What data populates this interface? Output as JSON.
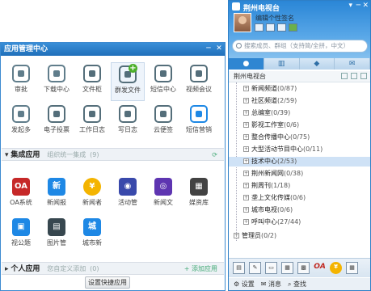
{
  "app_manager": {
    "title": "应用管理中心",
    "apps_row1": [
      {
        "label": "审批",
        "icon": "approval-icon",
        "color": "#607d8b"
      },
      {
        "label": "下载中心",
        "icon": "download-icon",
        "color": "#607d8b"
      },
      {
        "label": "文件柜",
        "icon": "cabinet-icon",
        "color": "#546e7a"
      },
      {
        "label": "群发文件",
        "icon": "group-file-icon",
        "color": "#546e7a"
      },
      {
        "label": "短信中心",
        "icon": "sms-icon",
        "color": "#546e7a"
      },
      {
        "label": "视频会议",
        "icon": "video-meeting-icon",
        "color": "#546e7a"
      }
    ],
    "apps_row2": [
      {
        "label": "发起多",
        "icon": "initiate-icon",
        "color": "#607d8b"
      },
      {
        "label": "电子投票",
        "icon": "vote-icon",
        "color": "#546e7a"
      },
      {
        "label": "工作日志",
        "icon": "worklog-icon",
        "color": "#546e7a"
      },
      {
        "label": "写日志",
        "icon": "write-log-icon",
        "color": "#546e7a"
      },
      {
        "label": "云便签",
        "icon": "cloud-note-icon",
        "color": "#546e7a"
      },
      {
        "label": "短信营销",
        "icon": "sms-marketing-icon",
        "color": "#1e88e5"
      }
    ],
    "integrated": {
      "title": "集成应用",
      "subtitle": "组织统一集成",
      "count": "(9)",
      "apps_row1": [
        {
          "label": "OA系统",
          "icon": "oa-icon",
          "color": "#c62828",
          "glyph": "OA"
        },
        {
          "label": "新闻报",
          "icon": "news-icon",
          "color": "#1e88e5",
          "glyph": "新"
        },
        {
          "label": "新闻者",
          "icon": "yen-icon",
          "color": "#f4b400",
          "glyph": "¥"
        },
        {
          "label": "活动管",
          "icon": "event-icon",
          "color": "#3949ab",
          "glyph": "◉"
        },
        {
          "label": "新闻文",
          "icon": "news-text-icon",
          "color": "#5e35b1",
          "glyph": "◎"
        },
        {
          "label": "媒资库",
          "icon": "media-icon",
          "color": "#424242",
          "glyph": "▦"
        }
      ],
      "apps_row2": [
        {
          "label": "视公题",
          "icon": "topic-icon",
          "color": "#1e88e5",
          "glyph": "▣"
        },
        {
          "label": "图片管",
          "icon": "image-icon",
          "color": "#37474f",
          "glyph": "▤"
        },
        {
          "label": "城市新",
          "icon": "city-news-icon",
          "color": "#1e88e5",
          "glyph": "城"
        }
      ]
    },
    "personal": {
      "title": "个人应用",
      "subtitle": "您自定义添加",
      "count": "(0)",
      "add_label": "添加应用"
    },
    "setup_button": "设置快捷应用"
  },
  "im_panel": {
    "title": "荆州电视台",
    "signature": "编辑个性签名",
    "search_placeholder": "搜索成员、群组（支持简/全拼，中文）",
    "tabs": [
      "●",
      "▥",
      "◆",
      "✉"
    ],
    "tree_root": "荆州电视台",
    "nodes": [
      {
        "name": "新闻频道",
        "count": "(0/87)",
        "selected": false
      },
      {
        "name": "社区频道",
        "count": "(2/59)",
        "selected": false
      },
      {
        "name": "总编室",
        "count": "(0/39)",
        "selected": false
      },
      {
        "name": "影视工作室",
        "count": "(0/6)",
        "selected": false
      },
      {
        "name": "整合传播中心",
        "count": "(0/75)",
        "selected": false
      },
      {
        "name": "大型活动节目中心",
        "count": "(0/11)",
        "selected": false
      },
      {
        "name": "技术中心",
        "count": "(2/53)",
        "selected": true
      },
      {
        "name": "荆州新闻网",
        "count": "(0/38)",
        "selected": false
      },
      {
        "name": "荆周刊",
        "count": "(1/18)",
        "selected": false
      },
      {
        "name": "垄上文化传媒",
        "count": "(0/6)",
        "selected": false
      },
      {
        "name": "城市电视",
        "count": "(0/6)",
        "selected": false
      },
      {
        "name": "呼叫中心",
        "count": "(27/44)",
        "selected": false
      }
    ],
    "admin_node": {
      "name": "管理员",
      "count": "(0/2)"
    },
    "footer": {
      "settings": "设置",
      "messages": "消息",
      "search": "查找"
    }
  }
}
